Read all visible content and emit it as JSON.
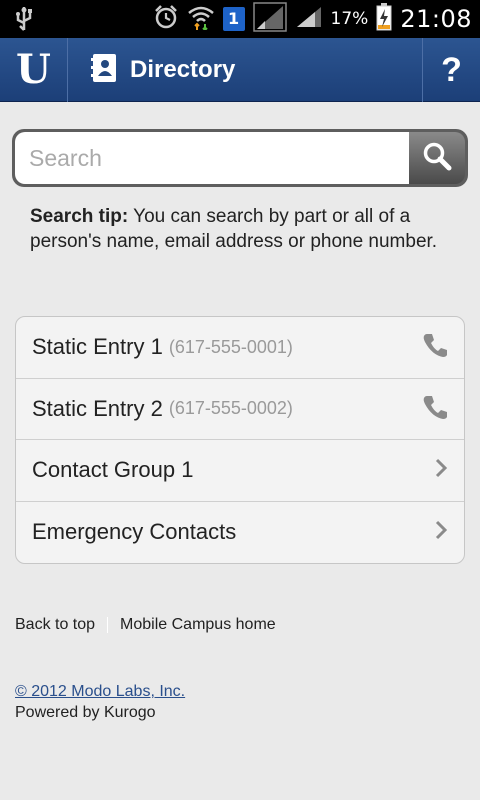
{
  "status_bar": {
    "battery_percent": "17%",
    "time": "21:08",
    "sim_slot": "1",
    "icons": [
      "usb-icon",
      "alarm-icon",
      "wifi-icon",
      "sim-icon",
      "signal-icon",
      "battery-icon"
    ]
  },
  "header": {
    "logo_letter": "U",
    "title": "Directory",
    "help_label": "?",
    "brand_color": "#23487f"
  },
  "search": {
    "placeholder": "Search",
    "value": ""
  },
  "tip": {
    "label": "Search tip:",
    "text": " You can search by part or all of a person's name, email address or phone number."
  },
  "entries": [
    {
      "title": "Static Entry 1",
      "subtitle": "(617-555-0001)",
      "icon": "phone-icon"
    },
    {
      "title": "Static Entry 2",
      "subtitle": "(617-555-0002)",
      "icon": "phone-icon"
    },
    {
      "title": "Contact Group 1",
      "subtitle": "",
      "icon": "chevron-right-icon"
    },
    {
      "title": "Emergency Contacts",
      "subtitle": "",
      "icon": "chevron-right-icon"
    }
  ],
  "footer": {
    "back_to_top": "Back to top",
    "campus_home": "Mobile Campus home",
    "copyright": "© 2012 Modo Labs, Inc.",
    "powered_by": "Powered by Kurogo"
  }
}
